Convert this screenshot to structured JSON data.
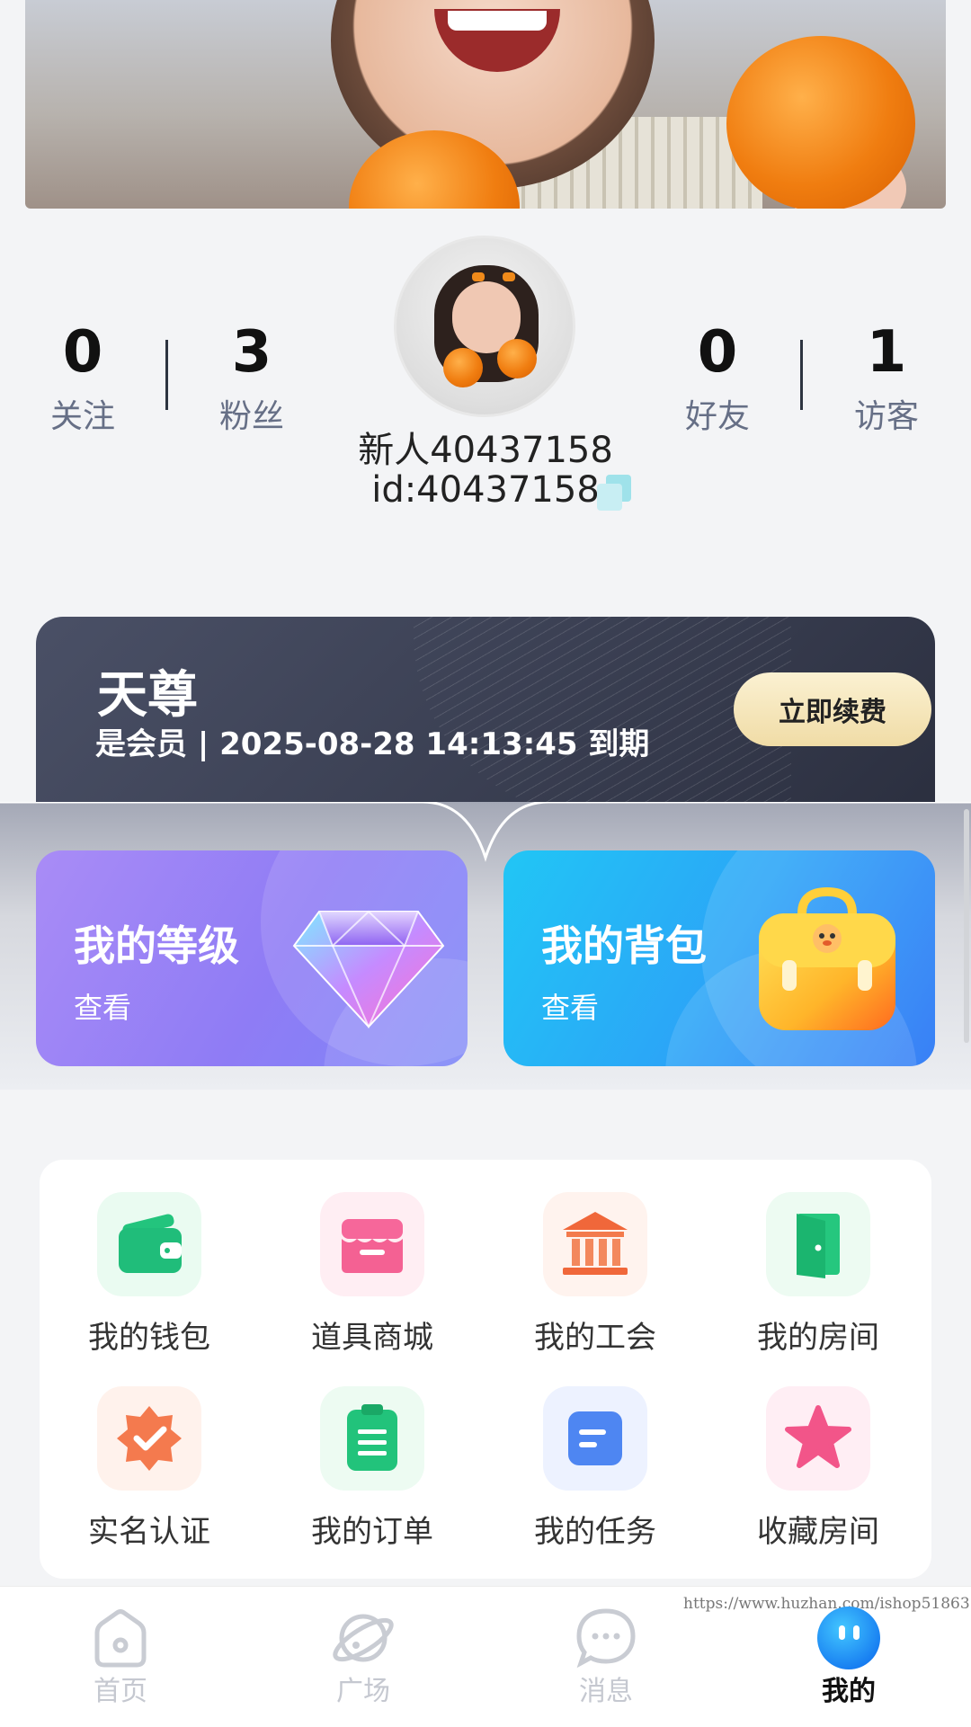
{
  "stats_left": [
    {
      "value": "0",
      "label": "关注"
    },
    {
      "value": "3",
      "label": "粉丝"
    }
  ],
  "stats_right": [
    {
      "value": "0",
      "label": "好友"
    },
    {
      "value": "1",
      "label": "访客"
    }
  ],
  "profile": {
    "nickname": "新人40437158",
    "id_text": "id:40437158"
  },
  "vip": {
    "title": "天尊",
    "subtitle": "是会员 | 2025-08-28 14:13:45 到期",
    "renew_label": "立即续费"
  },
  "feature_cards": [
    {
      "title": "我的等级",
      "action": "查看"
    },
    {
      "title": "我的背包",
      "action": "查看"
    }
  ],
  "grid_items": [
    {
      "label": "我的钱包",
      "icon": "wallet-icon"
    },
    {
      "label": "道具商城",
      "icon": "shop-icon"
    },
    {
      "label": "我的工会",
      "icon": "guild-icon"
    },
    {
      "label": "我的房间",
      "icon": "door-icon"
    },
    {
      "label": "实名认证",
      "icon": "verified-badge-icon"
    },
    {
      "label": "我的订单",
      "icon": "clipboard-icon"
    },
    {
      "label": "我的任务",
      "icon": "task-icon"
    },
    {
      "label": "收藏房间",
      "icon": "star-icon"
    }
  ],
  "bottom_nav": [
    {
      "label": "首页",
      "icon": "home-icon",
      "active": false
    },
    {
      "label": "广场",
      "icon": "planet-icon",
      "active": false
    },
    {
      "label": "消息",
      "icon": "chat-icon",
      "active": false
    },
    {
      "label": "我的",
      "icon": "profile-face-icon",
      "active": true
    }
  ],
  "watermark": "https://www.huzhan.com/ishop51863",
  "colors": {
    "accent_blue": "#1f8ef5",
    "vip_gold": "#f0dca6",
    "level_purple": "#8f7cf5",
    "bag_blue": "#2ba6f7"
  }
}
